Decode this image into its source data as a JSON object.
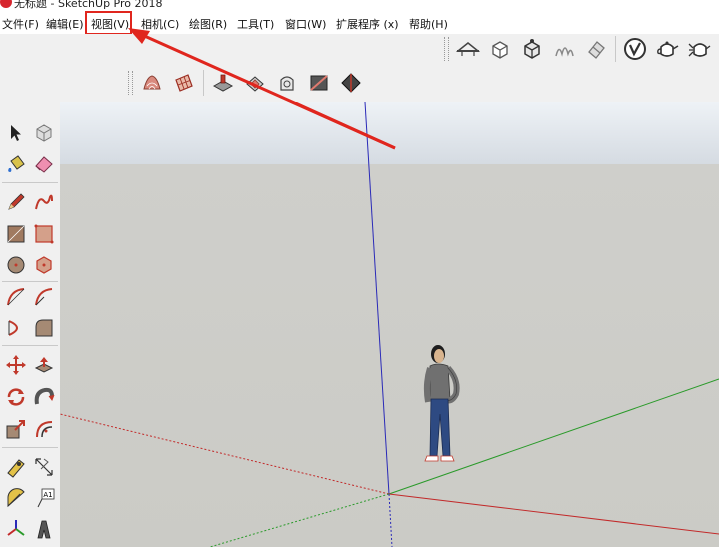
{
  "window": {
    "title": "无标题 - SketchUp Pro 2018"
  },
  "menu": {
    "items": [
      {
        "label": "文件(F)"
      },
      {
        "label": "编辑(E)"
      },
      {
        "label": "视图(V)"
      },
      {
        "label": "相机(C)"
      },
      {
        "label": "绘图(R)"
      },
      {
        "label": "工具(T)"
      },
      {
        "label": "窗口(W)"
      },
      {
        "label": "扩展程序 (x)"
      },
      {
        "label": "帮助(H)"
      }
    ],
    "highlighted": "视图(V)"
  },
  "colors": {
    "annotation": "#e0261e",
    "axis_blue": "#2a2ab8",
    "axis_green": "#2a9a2a",
    "axis_red": "#c22a2a",
    "sky": "#e4e9ee",
    "ground": "#cbcbc6"
  },
  "toolbars": {
    "top_right": [
      "section-plane-icon",
      "component-icon",
      "move-component-icon",
      "sandbox-icon",
      "eraser-style-icon",
      "vray-logo-icon",
      "teapot-render-icon",
      "teapot-light-icon"
    ],
    "top_middle": [
      "sandbox-smoove-icon",
      "sandbox-from-scratch-icon",
      "stamp-icon",
      "drape-icon",
      "add-detail-icon",
      "flip-edge-icon",
      "smooth-terrain-icon"
    ],
    "left": [
      "select-icon",
      "make-component-icon",
      "paint-bucket-icon",
      "eraser-icon",
      "pencil-icon",
      "freehand-icon",
      "rectangle-icon",
      "rotated-rectangle-icon",
      "circle-icon",
      "polygon-icon",
      "arc-icon",
      "pie-icon",
      "two-point-arc-icon",
      "three-point-arc-icon",
      "move-icon",
      "push-pull-icon",
      "rotate-icon",
      "follow-me-icon",
      "scale-icon",
      "offset-icon",
      "tape-measure-icon",
      "dimension-icon",
      "protractor-icon",
      "text-icon",
      "axes-icon",
      "3d-text-icon"
    ]
  },
  "viewport": {
    "model_figure": "person-figure",
    "annotation_arrow": "red-annotation-arrow"
  }
}
